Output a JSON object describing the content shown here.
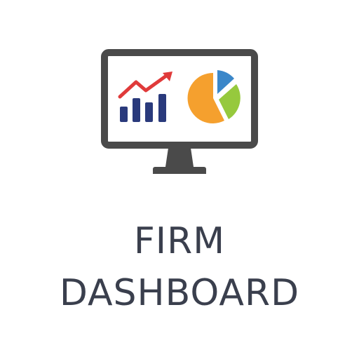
{
  "caption": {
    "line1": "FIRM",
    "line2": "DASHBOARD"
  },
  "icon": {
    "name": "monitor-dashboard-icon",
    "colors": {
      "monitor": "#4a4a4a",
      "screen": "#ffffff",
      "bars": "#2a3a7c",
      "trend_arrow": "#e03a3a",
      "pie_orange": "#f5a02e",
      "pie_blue": "#3b87c9",
      "pie_green": "#96c93d"
    }
  }
}
